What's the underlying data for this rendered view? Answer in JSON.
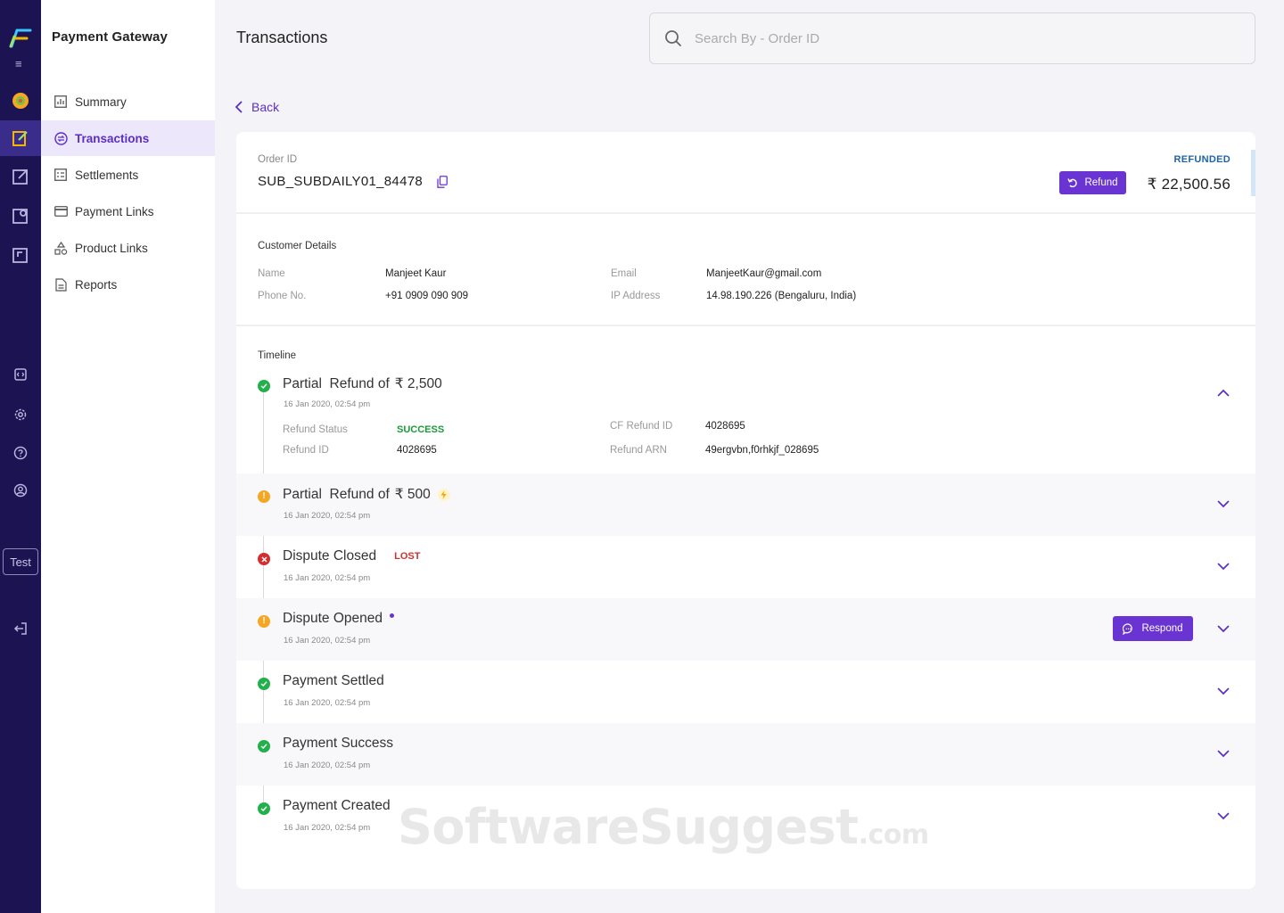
{
  "app": {
    "section_title": "Payment Gateway",
    "page_title": "Transactions",
    "env_badge": "Test"
  },
  "rail_icons": [
    "menu-icon",
    "product-switcher-icon",
    "payment-gateway-icon",
    "payouts-icon",
    "subscriptions-icon",
    "verification-icon",
    "developers-icon",
    "settings-icon",
    "help-icon",
    "profile-icon",
    "logout-icon"
  ],
  "sidebar": {
    "items": [
      {
        "label": "Summary",
        "icon": "bar-chart-icon",
        "active": false
      },
      {
        "label": "Transactions",
        "icon": "transactions-icon",
        "active": true
      },
      {
        "label": "Settlements",
        "icon": "settlements-icon",
        "active": false
      },
      {
        "label": "Payment Links",
        "icon": "card-icon",
        "active": false
      },
      {
        "label": "Product Links",
        "icon": "shapes-icon",
        "active": false
      },
      {
        "label": "Reports",
        "icon": "document-icon",
        "active": false
      }
    ]
  },
  "search": {
    "placeholder": "Search By - Order ID",
    "value": ""
  },
  "back_label": "Back",
  "order": {
    "id_label": "Order ID",
    "id": "SUB_SUBDAILY01_84478",
    "status": "REFUNDED",
    "refund_button": "Refund",
    "amount": "₹ 22,500.56"
  },
  "customer": {
    "title": "Customer Details",
    "name_label": "Name",
    "name": "Manjeet Kaur",
    "phone_label": "Phone No.",
    "phone": "+91 0909 090 909",
    "email_label": "Email",
    "email": "ManjeetKaur@gmail.com",
    "ip_label": "IP Address",
    "ip": "14.98.190.226 (Bengaluru, India)"
  },
  "timeline": {
    "title": "Timeline",
    "events": [
      {
        "title": "Partial  Refund of",
        "amount": "₹ 2,500",
        "date": "16 Jan 2020, 02:54 pm",
        "status_icon": "success",
        "expanded": true,
        "details": {
          "refund_status_label": "Refund Status",
          "refund_status": "SUCCESS",
          "refund_id_label": "Refund ID",
          "refund_id": "4028695",
          "cf_refund_id_label": "CF Refund ID",
          "cf_refund_id": "4028695",
          "refund_arn_label": "Refund ARN",
          "refund_arn": "49ergvbn,f0rhkjf_028695"
        }
      },
      {
        "title": "Partial  Refund of",
        "amount": "₹ 500",
        "date": "16 Jan 2020, 02:54 pm",
        "status_icon": "warning",
        "badge": "instant-bolt-icon"
      },
      {
        "title": "Dispute Closed",
        "tag": "LOST",
        "date": "16 Jan 2020, 02:54 pm",
        "status_icon": "error"
      },
      {
        "title": "Dispute Opened",
        "date": "16 Jan 2020, 02:54 pm",
        "status_icon": "warning",
        "action": "Respond"
      },
      {
        "title": "Payment Settled",
        "date": "16 Jan 2020, 02:54 pm",
        "status_icon": "success"
      },
      {
        "title": "Payment Success",
        "date": "16 Jan 2020, 02:54 pm",
        "status_icon": "success"
      },
      {
        "title": "Payment Created",
        "date": "16 Jan 2020, 02:54 pm",
        "status_icon": "success"
      }
    ]
  },
  "watermark": {
    "main": "SoftwareSuggest",
    "suffix": ".com"
  },
  "colors": {
    "rail_bg": "#1c1452",
    "accent": "#6a34d2",
    "success": "#22b04b",
    "warning": "#f5a623",
    "error": "#d32f2f",
    "refunded": "#1f63a8"
  }
}
